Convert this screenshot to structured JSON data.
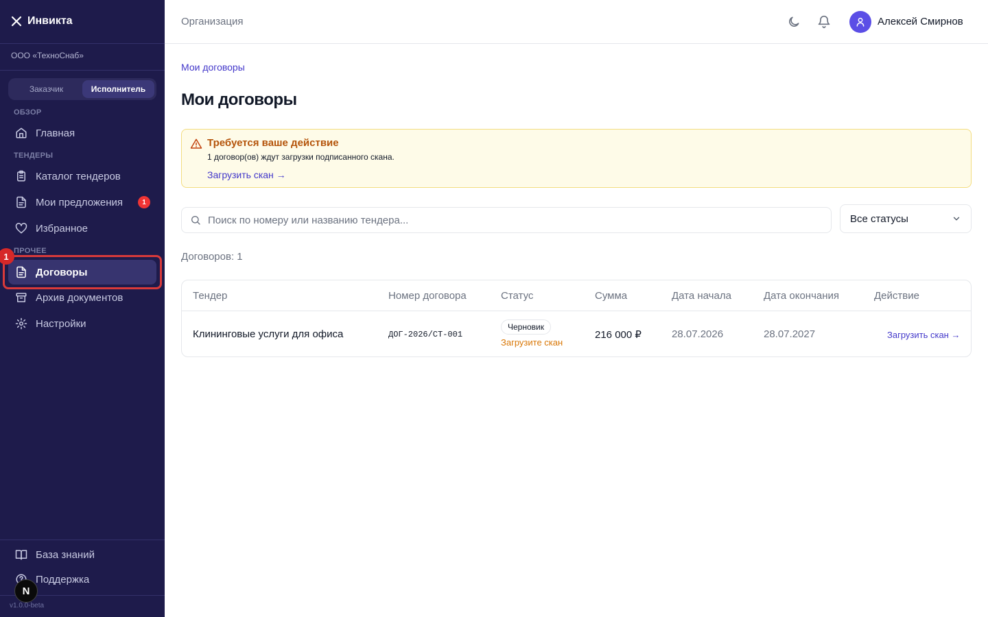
{
  "app": {
    "name": "Инвикта",
    "version": "v1.0.0-beta"
  },
  "sidebar": {
    "org": "ООО «ТехноСнаб»",
    "roles": [
      "Заказчик",
      "Исполнитель"
    ],
    "active_role": "Исполнитель",
    "sections": {
      "overview": "ОБЗОР",
      "tenders": "ТЕНДЕРЫ",
      "other": "ПРОЧЕЕ"
    },
    "items": {
      "home": "Главная",
      "catalog": "Каталог тендеров",
      "offers": "Мои предложения",
      "offers_badge": "1",
      "favorites": "Избранное",
      "contracts": "Договоры",
      "archive": "Архив документов",
      "settings": "Настройки",
      "knowledge": "База знаний",
      "support": "Поддержка"
    },
    "highlight_badge": "1",
    "dev_badge": "N"
  },
  "topbar": {
    "breadcrumb": "Организация",
    "user_name": "Алексей Смирнов"
  },
  "page": {
    "breadcrumb": "Мои договоры",
    "title": "Мои договоры",
    "alert": {
      "title": "Требуется ваше действие",
      "text": "1 договор(ов) ждут загрузки подписанного скана.",
      "link": "Загрузить скан →"
    },
    "search_placeholder": "Поиск по номеру или названию тендера...",
    "status_filter": "Все статусы",
    "count": "Договоров: 1"
  },
  "table": {
    "headers": [
      "Тендер",
      "Номер договора",
      "Статус",
      "Сумма",
      "Дата начала",
      "Дата окончания",
      "Действие"
    ],
    "rows": [
      {
        "tender": "Клининговые услуги для офиса",
        "number": "ДОГ-2026/СТ-001",
        "status": "Черновик",
        "status_note": "Загрузите скан",
        "amount": "216 000 ₽",
        "start": "28.07.2026",
        "end": "28.07.2027",
        "action": "Загрузить скан →"
      }
    ]
  }
}
